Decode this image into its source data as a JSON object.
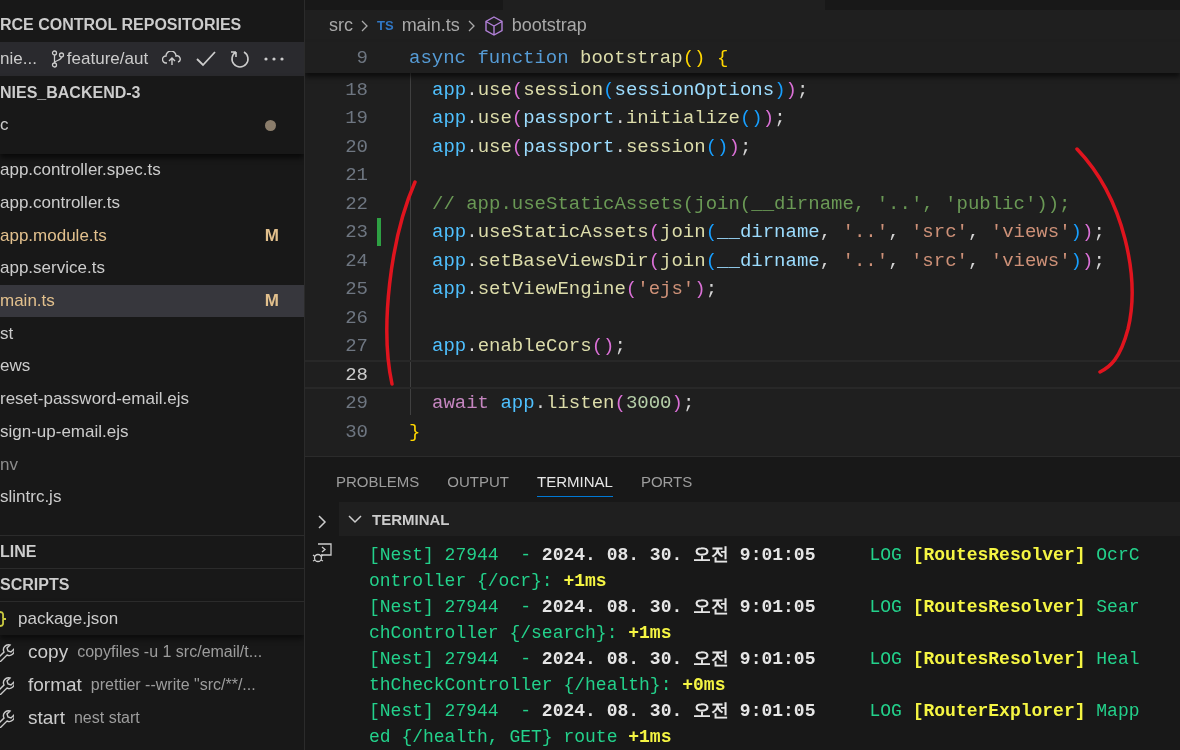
{
  "sidebar": {
    "section_title": "RCE CONTROL REPOSITORIES",
    "repo": {
      "name": "nie...",
      "branch": "feature/aut"
    },
    "explorer_title": "NIES_BACKEND-3",
    "folder": {
      "name": "c",
      "modified_dot": true
    },
    "files": [
      {
        "name": "app.controller.spec.ts",
        "selected": false,
        "dimmed": false
      },
      {
        "name": "app.controller.ts",
        "selected": false,
        "dimmed": false
      },
      {
        "name": "app.module.ts",
        "status": "M",
        "selected": false,
        "dimmed": false
      },
      {
        "name": "app.service.ts",
        "selected": false,
        "dimmed": false
      },
      {
        "name": "main.ts",
        "status": "M",
        "selected": true,
        "dimmed": false
      },
      {
        "name": "st",
        "selected": false,
        "dimmed": false
      },
      {
        "name": "ews",
        "selected": false,
        "dimmed": false
      },
      {
        "name": "reset-password-email.ejs",
        "selected": false,
        "dimmed": false
      },
      {
        "name": "sign-up-email.ejs",
        "selected": false,
        "dimmed": false
      },
      {
        "name": "nv",
        "selected": false,
        "dimmed": true
      },
      {
        "name": "slintrc.js",
        "selected": false,
        "dimmed": false
      }
    ],
    "outline_title": "LINE",
    "scripts_title": "SCRIPTS",
    "package": "package.json",
    "scripts": [
      {
        "name": "copy",
        "command": "copyfiles -u 1 src/email/t..."
      },
      {
        "name": "format",
        "command": "prettier --write \"src/**/..."
      },
      {
        "name": "start",
        "command": "nest start"
      }
    ]
  },
  "breadcrumb": {
    "folder": "src",
    "file_icon": "TS",
    "file": "main.ts",
    "symbol": "bootstrap"
  },
  "sticky_line": {
    "number": "9",
    "tokens": [
      {
        "text": "async ",
        "kind": "keyword"
      },
      {
        "text": "function ",
        "kind": "keyword"
      },
      {
        "text": "bootstrap",
        "kind": "function"
      },
      {
        "text": "()",
        "kind": "bracket1"
      },
      {
        "text": " {",
        "kind": "bracket1"
      }
    ]
  },
  "code_lines": [
    {
      "number": "18",
      "modified": false,
      "current": false,
      "tokens": [
        {
          "text": "app",
          "kind": "object"
        },
        {
          "text": ".",
          "kind": "punct"
        },
        {
          "text": "use",
          "kind": "function"
        },
        {
          "text": "(",
          "kind": "bracket2"
        },
        {
          "text": "session",
          "kind": "function"
        },
        {
          "text": "(",
          "kind": "bracket3"
        },
        {
          "text": "sessionOptions",
          "kind": "variable"
        },
        {
          "text": ")",
          "kind": "bracket3"
        },
        {
          "text": ")",
          "kind": "bracket2"
        },
        {
          "text": ";",
          "kind": "punct"
        }
      ]
    },
    {
      "number": "19",
      "modified": false,
      "current": false,
      "tokens": [
        {
          "text": "app",
          "kind": "object"
        },
        {
          "text": ".",
          "kind": "punct"
        },
        {
          "text": "use",
          "kind": "function"
        },
        {
          "text": "(",
          "kind": "bracket2"
        },
        {
          "text": "passport",
          "kind": "variable"
        },
        {
          "text": ".",
          "kind": "punct"
        },
        {
          "text": "initialize",
          "kind": "function"
        },
        {
          "text": "()",
          "kind": "bracket3"
        },
        {
          "text": ")",
          "kind": "bracket2"
        },
        {
          "text": ";",
          "kind": "punct"
        }
      ]
    },
    {
      "number": "20",
      "modified": false,
      "current": false,
      "tokens": [
        {
          "text": "app",
          "kind": "object"
        },
        {
          "text": ".",
          "kind": "punct"
        },
        {
          "text": "use",
          "kind": "function"
        },
        {
          "text": "(",
          "kind": "bracket2"
        },
        {
          "text": "passport",
          "kind": "variable"
        },
        {
          "text": ".",
          "kind": "punct"
        },
        {
          "text": "session",
          "kind": "function"
        },
        {
          "text": "()",
          "kind": "bracket3"
        },
        {
          "text": ")",
          "kind": "bracket2"
        },
        {
          "text": ";",
          "kind": "punct"
        }
      ]
    },
    {
      "number": "21",
      "modified": false,
      "current": false
    },
    {
      "number": "22",
      "modified": false,
      "current": false,
      "tokens": [
        {
          "text": "// app.useStaticAssets(join(__dirname, '..', 'public'));",
          "kind": "comment"
        }
      ]
    },
    {
      "number": "23",
      "modified": true,
      "current": false,
      "tokens": [
        {
          "text": "app",
          "kind": "object"
        },
        {
          "text": ".",
          "kind": "punct"
        },
        {
          "text": "useStaticAssets",
          "kind": "function"
        },
        {
          "text": "(",
          "kind": "bracket2"
        },
        {
          "text": "join",
          "kind": "function"
        },
        {
          "text": "(",
          "kind": "bracket3"
        },
        {
          "text": "__dirname",
          "kind": "variable"
        },
        {
          "text": ", ",
          "kind": "punct"
        },
        {
          "text": "'..'",
          "kind": "string"
        },
        {
          "text": ", ",
          "kind": "punct"
        },
        {
          "text": "'src'",
          "kind": "string"
        },
        {
          "text": ", ",
          "kind": "punct"
        },
        {
          "text": "'views'",
          "kind": "string"
        },
        {
          "text": ")",
          "kind": "bracket3"
        },
        {
          "text": ")",
          "kind": "bracket2"
        },
        {
          "text": ";",
          "kind": "punct"
        }
      ]
    },
    {
      "number": "24",
      "modified": false,
      "current": false,
      "tokens": [
        {
          "text": "app",
          "kind": "object"
        },
        {
          "text": ".",
          "kind": "punct"
        },
        {
          "text": "setBaseViewsDir",
          "kind": "function"
        },
        {
          "text": "(",
          "kind": "bracket2"
        },
        {
          "text": "join",
          "kind": "function"
        },
        {
          "text": "(",
          "kind": "bracket3"
        },
        {
          "text": "__dirname",
          "kind": "variable"
        },
        {
          "text": ", ",
          "kind": "punct"
        },
        {
          "text": "'..'",
          "kind": "string"
        },
        {
          "text": ", ",
          "kind": "punct"
        },
        {
          "text": "'src'",
          "kind": "string"
        },
        {
          "text": ", ",
          "kind": "punct"
        },
        {
          "text": "'views'",
          "kind": "string"
        },
        {
          "text": ")",
          "kind": "bracket3"
        },
        {
          "text": ")",
          "kind": "bracket2"
        },
        {
          "text": ";",
          "kind": "punct"
        }
      ]
    },
    {
      "number": "25",
      "modified": false,
      "current": false,
      "tokens": [
        {
          "text": "app",
          "kind": "object"
        },
        {
          "text": ".",
          "kind": "punct"
        },
        {
          "text": "setViewEngine",
          "kind": "function"
        },
        {
          "text": "(",
          "kind": "bracket2"
        },
        {
          "text": "'ejs'",
          "kind": "string"
        },
        {
          "text": ")",
          "kind": "bracket2"
        },
        {
          "text": ";",
          "kind": "punct"
        }
      ]
    },
    {
      "number": "26",
      "modified": false,
      "current": false
    },
    {
      "number": "27",
      "modified": false,
      "current": false,
      "tokens": [
        {
          "text": "app",
          "kind": "object"
        },
        {
          "text": ".",
          "kind": "punct"
        },
        {
          "text": "enableCors",
          "kind": "function"
        },
        {
          "text": "()",
          "kind": "bracket2"
        },
        {
          "text": ";",
          "kind": "punct"
        }
      ]
    },
    {
      "number": "28",
      "modified": false,
      "current": true
    },
    {
      "number": "29",
      "modified": false,
      "current": false,
      "tokens": [
        {
          "text": "await ",
          "kind": "control"
        },
        {
          "text": "app",
          "kind": "object"
        },
        {
          "text": ".",
          "kind": "punct"
        },
        {
          "text": "listen",
          "kind": "function"
        },
        {
          "text": "(",
          "kind": "bracket2"
        },
        {
          "text": "3000",
          "kind": "number"
        },
        {
          "text": ")",
          "kind": "bracket2"
        },
        {
          "text": ";",
          "kind": "punct"
        }
      ]
    },
    {
      "number": "30",
      "modified": false,
      "current": false,
      "outdent": true,
      "tokens": [
        {
          "text": "}",
          "kind": "bracket1"
        }
      ]
    }
  ],
  "panel": {
    "tabs": [
      {
        "label": "PROBLEMS",
        "selected": false
      },
      {
        "label": "OUTPUT",
        "selected": false
      },
      {
        "label": "TERMINAL",
        "selected": true
      },
      {
        "label": "PORTS",
        "selected": false
      }
    ],
    "terminal_title": "TERMINAL",
    "lines": [
      [
        {
          "text": "[Nest] 27944  - ",
          "kind": "green"
        },
        {
          "text": "2024. 08. 30. 오전 9:01:05",
          "kind": "white"
        },
        {
          "text": "     LOG ",
          "kind": "green"
        },
        {
          "text": "[RoutesResolver]",
          "kind": "yellow"
        },
        {
          "text": " OcrC",
          "kind": "green"
        }
      ],
      [
        {
          "text": "ontroller {/ocr}: ",
          "kind": "green"
        },
        {
          "text": "+1ms",
          "kind": "yellow"
        }
      ],
      [
        {
          "text": "[Nest] 27944  - ",
          "kind": "green"
        },
        {
          "text": "2024. 08. 30. 오전 9:01:05",
          "kind": "white"
        },
        {
          "text": "     LOG ",
          "kind": "green"
        },
        {
          "text": "[RoutesResolver]",
          "kind": "yellow"
        },
        {
          "text": " Sear",
          "kind": "green"
        }
      ],
      [
        {
          "text": "chController {/search}: ",
          "kind": "green"
        },
        {
          "text": "+1ms",
          "kind": "yellow"
        }
      ],
      [
        {
          "text": "[Nest] 27944  - ",
          "kind": "green"
        },
        {
          "text": "2024. 08. 30. 오전 9:01:05",
          "kind": "white"
        },
        {
          "text": "     LOG ",
          "kind": "green"
        },
        {
          "text": "[RoutesResolver]",
          "kind": "yellow"
        },
        {
          "text": " Heal",
          "kind": "green"
        }
      ],
      [
        {
          "text": "thCheckController {/health}: ",
          "kind": "green"
        },
        {
          "text": "+0ms",
          "kind": "yellow"
        }
      ],
      [
        {
          "text": "[Nest] 27944  - ",
          "kind": "green"
        },
        {
          "text": "2024. 08. 30. 오전 9:01:05",
          "kind": "white"
        },
        {
          "text": "     LOG ",
          "kind": "green"
        },
        {
          "text": "[RouterExplorer]",
          "kind": "yellow"
        },
        {
          "text": " Mapp",
          "kind": "green"
        }
      ],
      [
        {
          "text": "ed {/health, GET} route ",
          "kind": "green"
        },
        {
          "text": "+1ms",
          "kind": "yellow"
        }
      ]
    ]
  }
}
